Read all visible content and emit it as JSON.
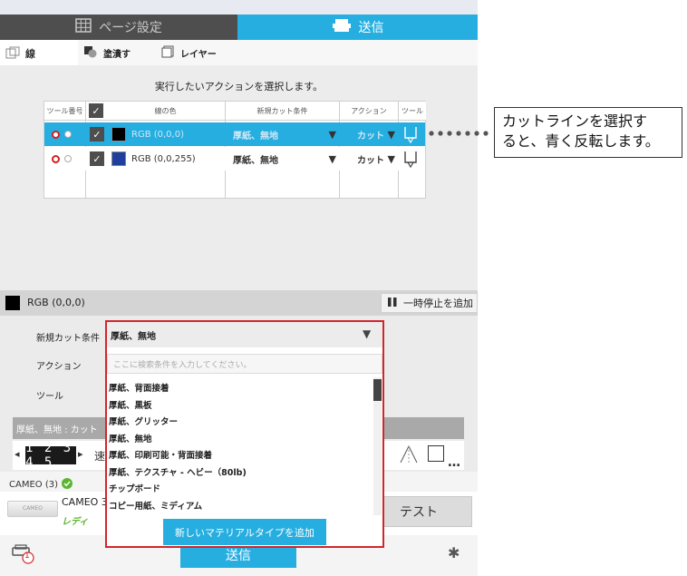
{
  "top_tabs": {
    "page_setup": "ページ設定",
    "send": "送信"
  },
  "sub_tabs": {
    "line": "線",
    "fill": "塗潰す",
    "layer": "レイヤー"
  },
  "action_panel": {
    "instruction": "実行したいアクションを選択します。",
    "columns": [
      "ツール番号",
      "",
      "線の色",
      "新規カット条件",
      "アクション",
      "ツール"
    ],
    "rows": [
      {
        "color_label": "RGB (0,0,0)",
        "swatch": "#000000",
        "condition": "厚紙、無地",
        "action": "カット",
        "selected": true
      },
      {
        "color_label": "RGB (0,0,255)",
        "swatch": "#1f3f9e",
        "condition": "厚紙、無地",
        "action": "カット",
        "selected": false
      }
    ]
  },
  "callout": {
    "line1": "カットラインを選択す",
    "line2": "ると、青く反転します。"
  },
  "color_bar": {
    "label": "RGB (0,0,0)",
    "pause_button": "一時停止を追加"
  },
  "settings": {
    "condition_label": "新規カット条件",
    "action_label": "アクション",
    "tool_label": "ツール",
    "summary": "厚紙、無地 : カット",
    "step_digits": "1 2 3 4 5",
    "speed_label_partial": "速"
  },
  "dropdown": {
    "selected": "厚紙、無地",
    "search_placeholder": "ここに検索条件を入力してください。",
    "items": [
      "厚紙、背面接着",
      "厚紙、黒板",
      "厚紙、グリッター",
      "厚紙、無地",
      "厚紙、印刷可能・背面接着",
      "厚紙、テクスチャ - ヘビー（80lb)",
      "チップボード",
      "コピー用紙、ミディアム"
    ],
    "add_button": "新しいマテリアルタイプを追加"
  },
  "devices": {
    "header": "CAMEO (3)",
    "name": "CAMEO 3",
    "status": "レディ",
    "test_button": "テスト",
    "send_button": "送信",
    "cutter_image_text": "CAMEO",
    "queue_badge": "1"
  },
  "colors": {
    "accent": "#27aee0",
    "highlight_border": "#d3262b",
    "status_ok": "#5cb531"
  }
}
